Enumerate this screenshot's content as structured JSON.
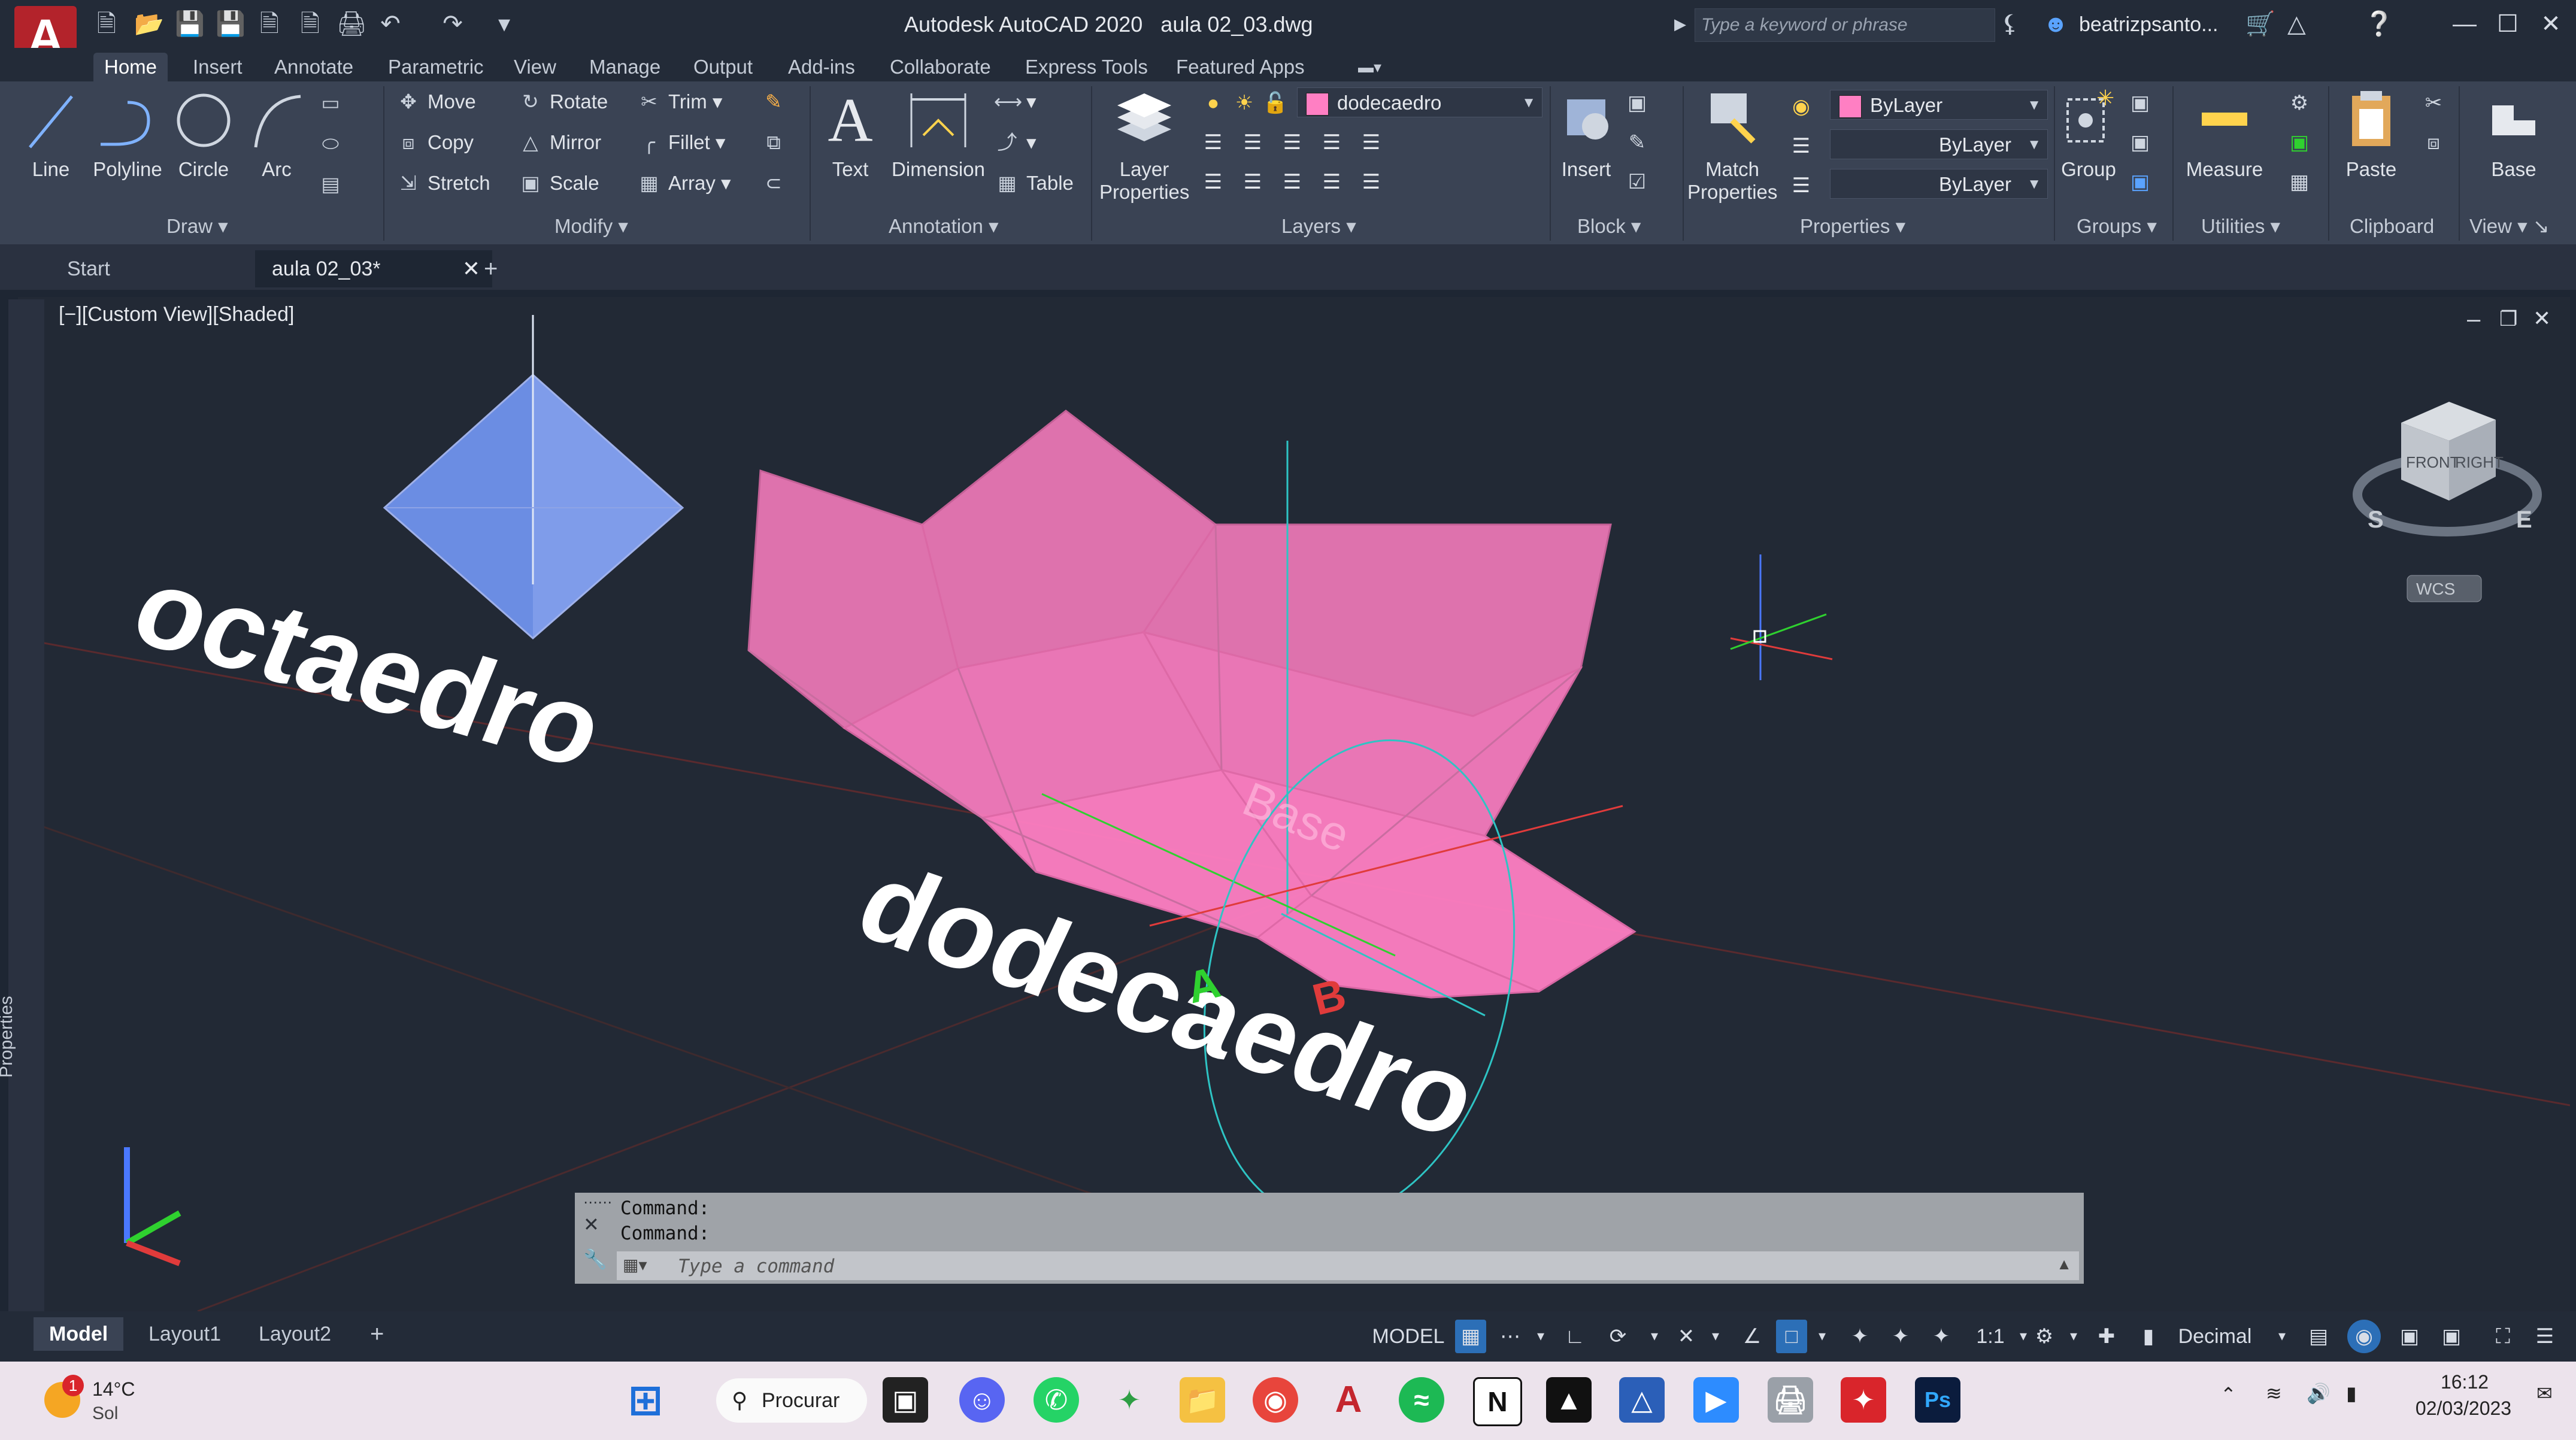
{
  "titlebar": {
    "app_title": "Autodesk AutoCAD 2020",
    "file_name": "aula 02_03.dwg",
    "search_placeholder": "Type a keyword or phrase",
    "user": "beatrizpsanto..."
  },
  "ribbon_tabs": [
    "Home",
    "Insert",
    "Annotate",
    "Parametric",
    "View",
    "Manage",
    "Output",
    "Add-ins",
    "Collaborate",
    "Express Tools",
    "Featured Apps"
  ],
  "ribbon": {
    "draw": {
      "title": "Draw",
      "line": "Line",
      "polyline": "Polyline",
      "circle": "Circle",
      "arc": "Arc"
    },
    "modify": {
      "title": "Modify",
      "move": "Move",
      "rotate": "Rotate",
      "trim": "Trim",
      "copy": "Copy",
      "mirror": "Mirror",
      "fillet": "Fillet",
      "stretch": "Stretch",
      "scale": "Scale",
      "array": "Array"
    },
    "annotation": {
      "title": "Annotation",
      "text": "Text",
      "dimension": "Dimension",
      "table": "Table"
    },
    "layers": {
      "title": "Layers",
      "layer_properties_1": "Layer",
      "layer_properties_2": "Properties",
      "current_layer": "dodecaedro"
    },
    "block": {
      "title": "Block",
      "insert": "Insert"
    },
    "properties": {
      "title": "Properties",
      "match_1": "Match",
      "match_2": "Properties",
      "color": "ByLayer",
      "linetype": "ByLayer",
      "lineweight": "ByLayer"
    },
    "groups": {
      "title": "Groups",
      "group": "Group"
    },
    "utilities": {
      "title": "Utilities",
      "measure": "Measure"
    },
    "clipboard": {
      "title": "Clipboard",
      "paste": "Paste"
    },
    "view": {
      "title": "View",
      "base": "Base"
    }
  },
  "doc_tabs": {
    "start": "Start",
    "active": "aula 02_03*"
  },
  "viewport": {
    "label": "[−][Custom View][Shaded]",
    "text_octaedro": "octaedro",
    "text_dodecaedro": "dodecaedro",
    "text_base": "Base",
    "label_a": "A",
    "label_b": "B",
    "viewcube_front": "FRONT",
    "viewcube_right": "RIGHT",
    "viewcube_s": "S",
    "viewcube_e": "E",
    "wcs": "WCS",
    "properties_palette": "Properties",
    "colors": {
      "octaedro": "#6b8de3",
      "dodecaedro": "#ff7fc3",
      "text": "#ffffff",
      "axis_x": "#e03b3b",
      "axis_y": "#2fd12f",
      "axis_z": "#4a78ff",
      "circle": "#2ec4c4"
    }
  },
  "command": {
    "history": [
      "Command:",
      "Command:"
    ],
    "placeholder": "Type a command"
  },
  "layout_tabs": [
    "Model",
    "Layout1",
    "Layout2"
  ],
  "status_bar": {
    "model": "MODEL",
    "scale": "1:1",
    "units": "Decimal"
  },
  "taskbar": {
    "weather_temp": "14°C",
    "weather_desc": "Sol",
    "weather_badge": "1",
    "search": "Procurar",
    "time": "16:12",
    "date": "02/03/2023",
    "apps": [
      "windows",
      "file-explorer-dark",
      "discord",
      "whatsapp",
      "maps",
      "folder",
      "chrome",
      "autocad",
      "spotify",
      "notion",
      "inkscape",
      "sketch",
      "zoom",
      "printer",
      "acrobat",
      "photoshop"
    ]
  }
}
